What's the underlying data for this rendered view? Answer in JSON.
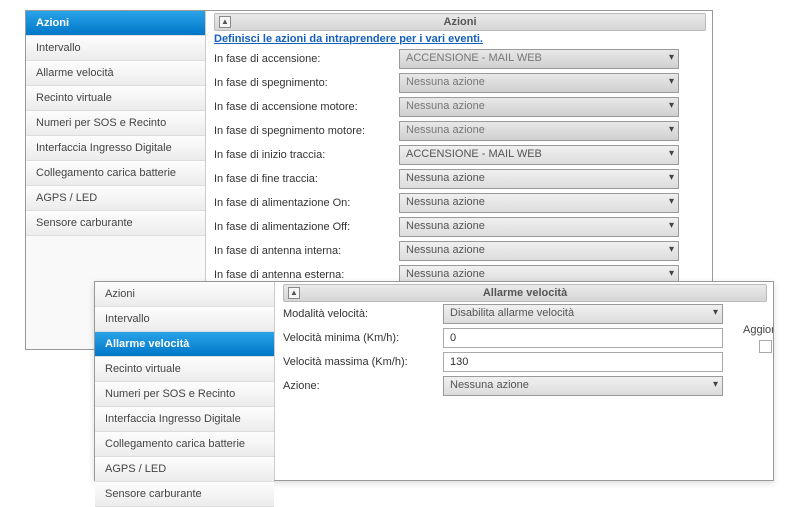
{
  "top": {
    "sidebar": {
      "items": [
        {
          "label": "Azioni",
          "active": true
        },
        {
          "label": "Intervallo"
        },
        {
          "label": "Allarme velocità"
        },
        {
          "label": "Recinto virtuale"
        },
        {
          "label": "Numeri per SOS e Recinto"
        },
        {
          "label": "Interfaccia Ingresso Digitale"
        },
        {
          "label": "Collegamento carica batterie"
        },
        {
          "label": "AGPS / LED"
        },
        {
          "label": "Sensore carburante"
        }
      ]
    },
    "header": "Azioni",
    "intro": "Definisci le azioni da intraprendere per i vari eventi.",
    "rows": [
      {
        "label": "In fase di accensione:",
        "value": "ACCENSIONE - MAIL WEB",
        "disabled": true
      },
      {
        "label": "In fase di spegnimento:",
        "value": "Nessuna azione",
        "disabled": true
      },
      {
        "label": "In fase di accensione motore:",
        "value": "Nessuna azione",
        "disabled": true
      },
      {
        "label": "In fase di spegnimento motore:",
        "value": "Nessuna azione",
        "disabled": true
      },
      {
        "label": "In fase di inizio traccia:",
        "value": "ACCENSIONE - MAIL WEB"
      },
      {
        "label": "In fase di fine traccia:",
        "value": "Nessuna azione"
      },
      {
        "label": "In fase di alimentazione On:",
        "value": "Nessuna azione"
      },
      {
        "label": "In fase di alimentazione Off:",
        "value": "Nessuna azione"
      },
      {
        "label": "In fase di antenna interna:",
        "value": "Nessuna azione"
      },
      {
        "label": "In fase di antenna esterna:",
        "value": "Nessuna azione"
      }
    ]
  },
  "bottom": {
    "sidebar": {
      "items": [
        {
          "label": "Azioni"
        },
        {
          "label": "Intervallo"
        },
        {
          "label": "Allarme velocità",
          "active": true
        },
        {
          "label": "Recinto virtuale"
        },
        {
          "label": "Numeri per SOS e Recinto"
        },
        {
          "label": "Interfaccia Ingresso Digitale"
        },
        {
          "label": "Collegamento carica batterie"
        },
        {
          "label": "AGPS / LED"
        },
        {
          "label": "Sensore carburante"
        }
      ]
    },
    "header": "Allarme velocità",
    "rows": {
      "mode": {
        "label": "Modalità velocità:",
        "value": "Disabilita allarme velocità"
      },
      "min": {
        "label": "Velocità minima (Km/h):",
        "value": "0"
      },
      "max": {
        "label": "Velocità massima (Km/h):",
        "value": "130"
      },
      "action": {
        "label": "Azione:",
        "value": "Nessuna azione"
      }
    },
    "update_label": "Aggiorna"
  }
}
